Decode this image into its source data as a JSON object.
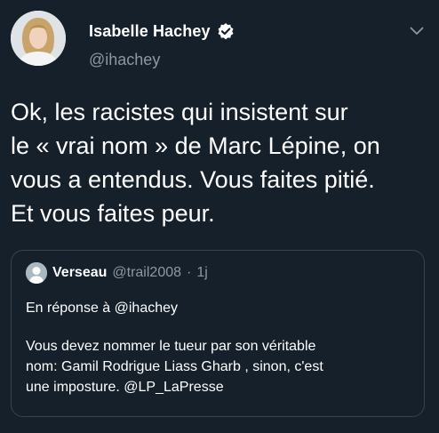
{
  "author": {
    "display_name": "Isabelle Hachey",
    "handle": "@ihachey",
    "verified": true,
    "avatar_icon": "profile-photo-icon"
  },
  "tweet": {
    "text": "Ok, les racistes qui insistent sur\nle « vrai nom » de Marc Lépine, on\nvous a entendus. Vous faites pitié.\nEt vous faites peur."
  },
  "quoted_tweet": {
    "display_name": "Verseau",
    "handle": "@trail2008",
    "separator": "·",
    "time": "1j",
    "reply_to": "En réponse à @ihachey",
    "text": "Vous devez nommer le tueur par son véritable\nnom: Gamil Rodrigue Liass Gharb , sinon, c'est\nune imposture. @LP_LaPresse"
  },
  "colors": {
    "background": "#15202b",
    "secondary_text": "#8b98a5",
    "border": "#38444d",
    "verified_badge": "#ffffff"
  }
}
